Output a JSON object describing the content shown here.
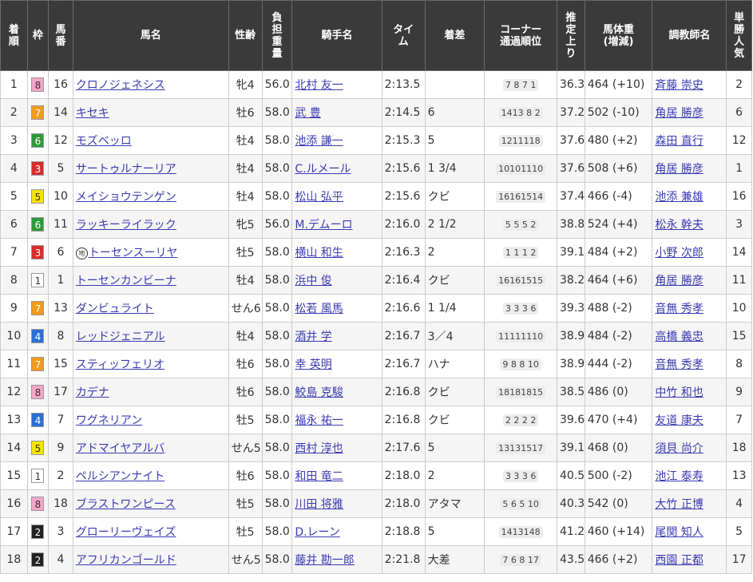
{
  "headers": {
    "rank": [
      "着",
      "順"
    ],
    "waku": [
      "枠"
    ],
    "umaban": [
      "馬",
      "番"
    ],
    "horse": [
      "馬名"
    ],
    "sexage": [
      "性齢"
    ],
    "weight": [
      "負",
      "担",
      "重",
      "量"
    ],
    "jockey": [
      "騎手名"
    ],
    "time": [
      "タイ",
      "ム"
    ],
    "margin": [
      "着差"
    ],
    "corner": [
      "コーナー",
      "通過順位"
    ],
    "agari": [
      "推",
      "定",
      "上",
      "り"
    ],
    "bodyweight": [
      "馬体重",
      "(増減)"
    ],
    "trainer": [
      "調教師名"
    ],
    "pop": [
      "単",
      "勝",
      "人",
      "気"
    ]
  },
  "waku_colors": {
    "1": {
      "bg": "#ffffff",
      "fg": "#333333"
    },
    "2": {
      "bg": "#222222",
      "fg": "#ffffff"
    },
    "3": {
      "bg": "#d62c2c",
      "fg": "#ffffff"
    },
    "4": {
      "bg": "#2a6fd6",
      "fg": "#ffffff"
    },
    "5": {
      "bg": "#f5e400",
      "fg": "#333333"
    },
    "6": {
      "bg": "#2e9a3c",
      "fg": "#ffffff"
    },
    "7": {
      "bg": "#f39a1b",
      "fg": "#ffffff"
    },
    "8": {
      "bg": "#f3a6c8",
      "fg": "#333333"
    }
  },
  "chihou_mark": "地",
  "rows": [
    {
      "rank": "1",
      "waku": "8",
      "umaban": "16",
      "horse": "クロノジェネシス",
      "chihou": false,
      "sexage": "牝4",
      "weight": "56.0",
      "jockey": "北村 友一",
      "time": "2:13.5",
      "margin": "",
      "corner": "7 8 7 1",
      "agari": "36.3",
      "bodyweight": "464 (+10)",
      "trainer": "斉藤 崇史",
      "pop": "2"
    },
    {
      "rank": "2",
      "waku": "7",
      "umaban": "14",
      "horse": "キセキ",
      "chihou": false,
      "sexage": "牡6",
      "weight": "58.0",
      "jockey": "武 豊",
      "time": "2:14.5",
      "margin": "6",
      "corner": "1413 8 2",
      "agari": "37.2",
      "bodyweight": "502 (-10)",
      "trainer": "角居 勝彦",
      "pop": "6"
    },
    {
      "rank": "3",
      "waku": "6",
      "umaban": "12",
      "horse": "モズベッロ",
      "chihou": false,
      "sexage": "牡4",
      "weight": "58.0",
      "jockey": "池添 謙一",
      "time": "2:15.3",
      "margin": "5",
      "corner": "1211118",
      "agari": "37.6",
      "bodyweight": "480 (+2)",
      "trainer": "森田 直行",
      "pop": "12"
    },
    {
      "rank": "4",
      "waku": "3",
      "umaban": "5",
      "horse": "サートゥルナーリア",
      "chihou": false,
      "sexage": "牡4",
      "weight": "58.0",
      "jockey": "C.ルメール",
      "time": "2:15.6",
      "margin": "1 3/4",
      "corner": "10101110",
      "agari": "37.6",
      "bodyweight": "508 (+6)",
      "trainer": "角居 勝彦",
      "pop": "1"
    },
    {
      "rank": "5",
      "waku": "5",
      "umaban": "10",
      "horse": "メイショウテンゲン",
      "chihou": false,
      "sexage": "牡4",
      "weight": "58.0",
      "jockey": "松山 弘平",
      "time": "2:15.6",
      "margin": "クビ",
      "corner": "16161514",
      "agari": "37.4",
      "bodyweight": "466 (-4)",
      "trainer": "池添 兼雄",
      "pop": "16"
    },
    {
      "rank": "6",
      "waku": "6",
      "umaban": "11",
      "horse": "ラッキーライラック",
      "chihou": false,
      "sexage": "牝5",
      "weight": "56.0",
      "jockey": "M.デムーロ",
      "time": "2:16.0",
      "margin": "2 1/2",
      "corner": "5 5 5 2",
      "agari": "38.8",
      "bodyweight": "524 (+4)",
      "trainer": "松永 幹夫",
      "pop": "3"
    },
    {
      "rank": "7",
      "waku": "3",
      "umaban": "6",
      "horse": "トーセンスーリヤ",
      "chihou": true,
      "sexage": "牡5",
      "weight": "58.0",
      "jockey": "横山 和生",
      "time": "2:16.3",
      "margin": "2",
      "corner": "1 1 1 2",
      "agari": "39.1",
      "bodyweight": "484 (+2)",
      "trainer": "小野 次郎",
      "pop": "14"
    },
    {
      "rank": "8",
      "waku": "1",
      "umaban": "1",
      "horse": "トーセンカンビーナ",
      "chihou": false,
      "sexage": "牡4",
      "weight": "58.0",
      "jockey": "浜中 俊",
      "time": "2:16.4",
      "margin": "クビ",
      "corner": "16161515",
      "agari": "38.2",
      "bodyweight": "464 (+6)",
      "trainer": "角居 勝彦",
      "pop": "11"
    },
    {
      "rank": "9",
      "waku": "7",
      "umaban": "13",
      "horse": "ダンビュライト",
      "chihou": false,
      "sexage": "せん6",
      "weight": "58.0",
      "jockey": "松若 風馬",
      "time": "2:16.6",
      "margin": "1 1/4",
      "corner": "3 3 3 6",
      "agari": "39.3",
      "bodyweight": "488 (-2)",
      "trainer": "音無 秀孝",
      "pop": "10"
    },
    {
      "rank": "10",
      "waku": "4",
      "umaban": "8",
      "horse": "レッドジェニアル",
      "chihou": false,
      "sexage": "牡4",
      "weight": "58.0",
      "jockey": "酒井 学",
      "time": "2:16.7",
      "margin": "3／4",
      "corner": "11111110",
      "agari": "38.9",
      "bodyweight": "484 (-2)",
      "trainer": "高橋 義忠",
      "pop": "15"
    },
    {
      "rank": "11",
      "waku": "7",
      "umaban": "15",
      "horse": "スティッフェリオ",
      "chihou": false,
      "sexage": "牡6",
      "weight": "58.0",
      "jockey": "幸 英明",
      "time": "2:16.7",
      "margin": "ハナ",
      "corner": "9 8 8 10",
      "agari": "38.9",
      "bodyweight": "444 (-2)",
      "trainer": "音無 秀孝",
      "pop": "8"
    },
    {
      "rank": "12",
      "waku": "8",
      "umaban": "17",
      "horse": "カデナ",
      "chihou": false,
      "sexage": "牡6",
      "weight": "58.0",
      "jockey": "鮫島 克駿",
      "time": "2:16.8",
      "margin": "クビ",
      "corner": "18181815",
      "agari": "38.5",
      "bodyweight": "486 (0)",
      "trainer": "中竹 和也",
      "pop": "9"
    },
    {
      "rank": "13",
      "waku": "4",
      "umaban": "7",
      "horse": "ワグネリアン",
      "chihou": false,
      "sexage": "牡5",
      "weight": "58.0",
      "jockey": "福永 祐一",
      "time": "2:16.8",
      "margin": "クビ",
      "corner": "2 2 2 2",
      "agari": "39.6",
      "bodyweight": "470 (+4)",
      "trainer": "友道 康夫",
      "pop": "7"
    },
    {
      "rank": "14",
      "waku": "5",
      "umaban": "9",
      "horse": "アドマイヤアルバ",
      "chihou": false,
      "sexage": "せん5",
      "weight": "58.0",
      "jockey": "西村 淳也",
      "time": "2:17.6",
      "margin": "5",
      "corner": "13131517",
      "agari": "39.1",
      "bodyweight": "468 (0)",
      "trainer": "須貝 尚介",
      "pop": "18"
    },
    {
      "rank": "15",
      "waku": "1",
      "umaban": "2",
      "horse": "ペルシアンナイト",
      "chihou": false,
      "sexage": "牡6",
      "weight": "58.0",
      "jockey": "和田 竜二",
      "time": "2:18.0",
      "margin": "2",
      "corner": "3 3 3 6",
      "agari": "40.5",
      "bodyweight": "500 (-2)",
      "trainer": "池江 泰寿",
      "pop": "13"
    },
    {
      "rank": "16",
      "waku": "8",
      "umaban": "18",
      "horse": "ブラストワンピース",
      "chihou": false,
      "sexage": "牡5",
      "weight": "58.0",
      "jockey": "川田 将雅",
      "time": "2:18.0",
      "margin": "アタマ",
      "corner": "5 6 5 10",
      "agari": "40.3",
      "bodyweight": "542 (0)",
      "trainer": "大竹 正博",
      "pop": "4"
    },
    {
      "rank": "17",
      "waku": "2",
      "umaban": "3",
      "horse": "グローリーヴェイズ",
      "chihou": false,
      "sexage": "牡5",
      "weight": "58.0",
      "jockey": "D.レーン",
      "time": "2:18.8",
      "margin": "5",
      "corner": "1413148",
      "agari": "41.2",
      "bodyweight": "460 (+14)",
      "trainer": "尾関 知人",
      "pop": "5"
    },
    {
      "rank": "18",
      "waku": "2",
      "umaban": "4",
      "horse": "アフリカンゴールド",
      "chihou": false,
      "sexage": "せん5",
      "weight": "58.0",
      "jockey": "藤井 勘一郎",
      "time": "2:21.8",
      "margin": "大差",
      "corner": "7 6 8 17",
      "agari": "43.5",
      "bodyweight": "466 (+2)",
      "trainer": "西園 正都",
      "pop": "17"
    }
  ]
}
